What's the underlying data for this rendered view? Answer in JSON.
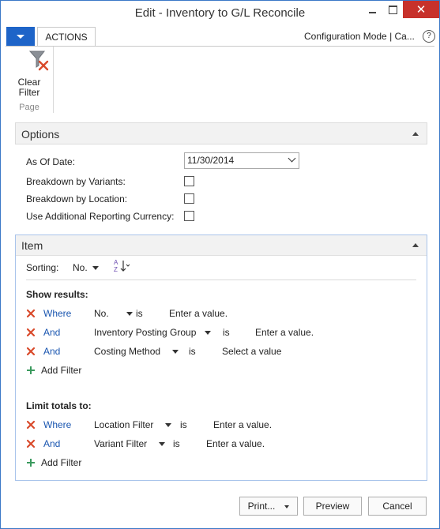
{
  "window": {
    "title": "Edit - Inventory to G/L Reconcile",
    "close_glyph": "✕"
  },
  "ribbon": {
    "tab_label": "ACTIONS",
    "config_mode": "Configuration Mode | Ca...",
    "help_glyph": "?",
    "clear_filter_line1": "Clear",
    "clear_filter_line2": "Filter",
    "group_label": "Page"
  },
  "options": {
    "header": "Options",
    "as_of_date_label": "As Of Date:",
    "as_of_date_value": "11/30/2014",
    "breakdown_variants_label": "Breakdown by Variants:",
    "breakdown_location_label": "Breakdown by Location:",
    "use_acy_label": "Use Additional Reporting Currency:"
  },
  "item": {
    "header": "Item",
    "sorting_label": "Sorting:",
    "sorting_value": "No.",
    "show_results_label": "Show results:",
    "show_filters": [
      {
        "conj": "Where",
        "field": "No.",
        "is": "is",
        "value": "Enter a value."
      },
      {
        "conj": "And",
        "field": "Inventory Posting Group",
        "is": "is",
        "value": "Enter a value."
      },
      {
        "conj": "And",
        "field": "Costing Method",
        "is": "is",
        "value": "Select a value"
      }
    ],
    "add_filter_label": "Add Filter",
    "limit_totals_label": "Limit totals to:",
    "limit_filters": [
      {
        "conj": "Where",
        "field": "Location Filter",
        "is": "is",
        "value": "Enter a value."
      },
      {
        "conj": "And",
        "field": "Variant Filter",
        "is": "is",
        "value": "Enter a value."
      }
    ]
  },
  "buttons": {
    "print": "Print...",
    "preview": "Preview",
    "cancel": "Cancel"
  }
}
